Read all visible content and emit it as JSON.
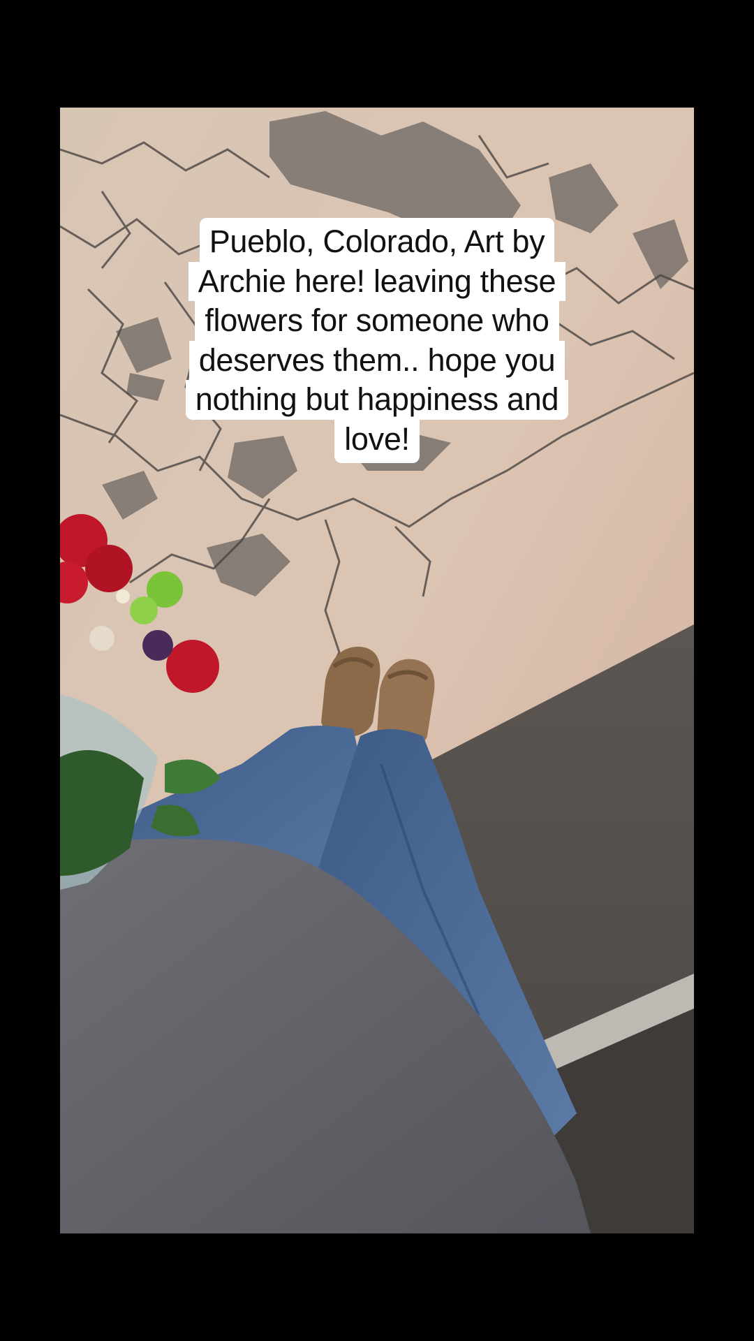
{
  "caption": {
    "lines": [
      "Pueblo, Colorado, Art by",
      "Archie here! leaving these",
      "flowers for someone who",
      "deserves them.. hope you",
      "nothing but happiness and",
      "love!"
    ]
  },
  "colors": {
    "background": "#000000",
    "caption_bg": "#ffffff",
    "caption_text": "#111111"
  }
}
